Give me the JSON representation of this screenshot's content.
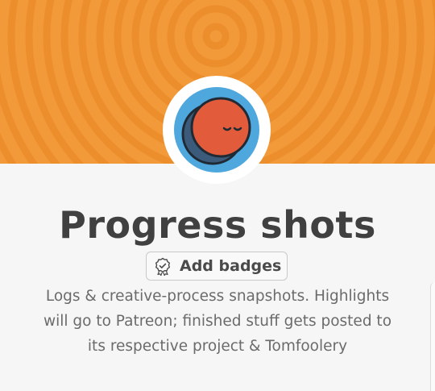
{
  "page": {
    "title": "Progress shots",
    "add_badges_label": "Add badges",
    "description_lines": [
      "Logs & creative-process snapshots. Highlights",
      "will go to Patreon; finished stuff gets posted to",
      "its respective project & Tomfoolery"
    ]
  },
  "banner": {
    "pattern": "concentric-rings",
    "color": "#f29a3a",
    "ring_color": "#ef8f2c"
  },
  "avatar": {
    "icon": "sleeping-moon-face-icon",
    "background_color": "#4fa8dd",
    "face_color": "#e25b3b"
  }
}
